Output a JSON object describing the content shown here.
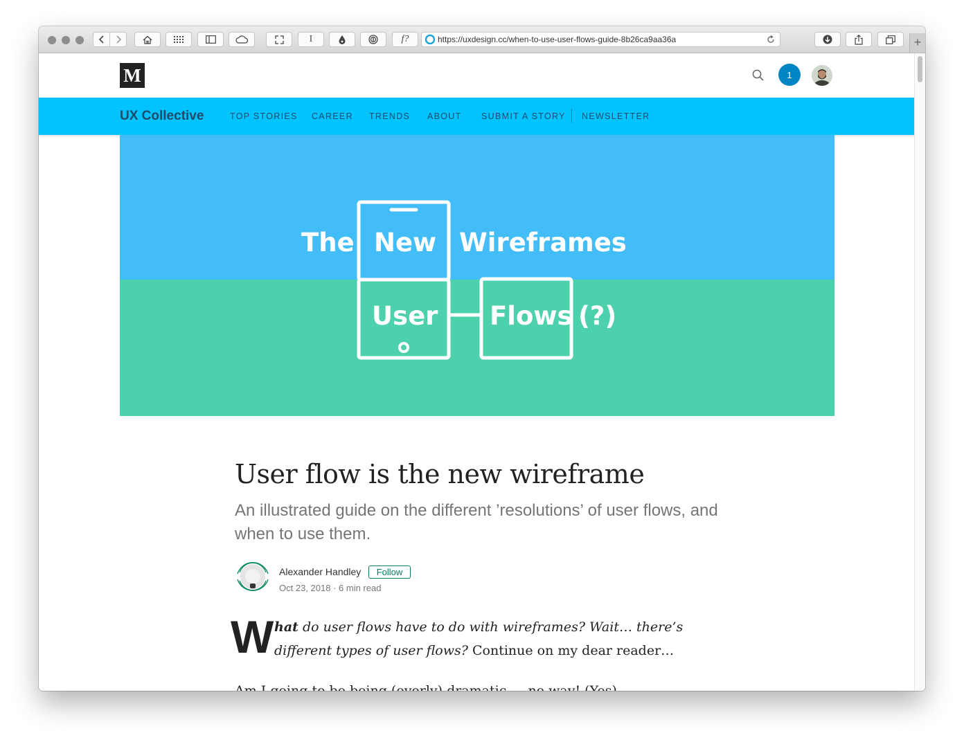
{
  "browser": {
    "url": "https://uxdesign.cc/when-to-use-user-flows-guide-8b26ca9aa36a",
    "reader_label": "I",
    "formula_label": "f?",
    "new_tab_label": "+"
  },
  "site": {
    "logo_letter": "M",
    "notifications_count": "1",
    "brand": "UX Collective",
    "nav": {
      "top_stories": "TOP STORIES",
      "career": "CAREER",
      "trends": "TRENDS",
      "about": "ABOUT",
      "submit": "SUBMIT A STORY",
      "newsletter": "NEWSLETTER"
    }
  },
  "hero": {
    "word_the": "The",
    "word_new": "New",
    "word_wireframes": "Wireframes",
    "word_user": "User",
    "word_flows": "Flows",
    "word_question": "(?)",
    "colors": {
      "top": "#42bdf7",
      "bottom": "#4dd1ad",
      "line": "#ffffff"
    }
  },
  "article": {
    "title": "User flow is the new wireframe",
    "subtitle": "An illustrated guide on the different ’resolutions’ of user flows, and when to use them.",
    "author": "Alexander Handley",
    "follow_label": "Follow",
    "date": "Oct 23, 2018",
    "read_time": "6 min read",
    "dropcap": "W",
    "lead_bold": "hat",
    "lead_italic": " do user flows have to do with wireframes? Wait… there’s different types of user flows?",
    "lead_normal": " Continue on my dear reader…",
    "next_line": "Am I going to be being (overly) dramatic — no way! (Yes)"
  }
}
